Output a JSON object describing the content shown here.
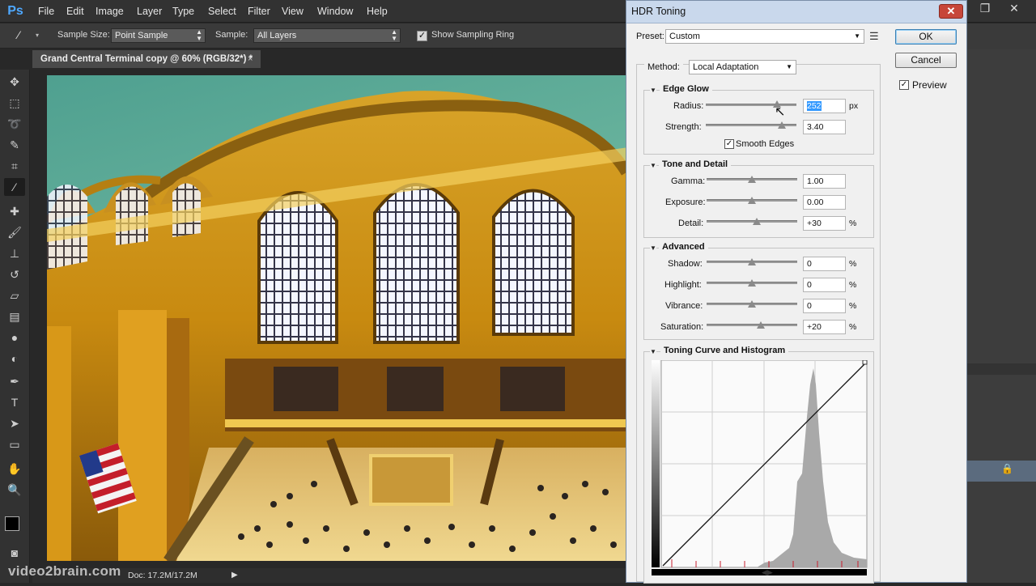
{
  "app": {
    "logo": "Ps",
    "menu": [
      "File",
      "Edit",
      "Image",
      "Layer",
      "Type",
      "Select",
      "Filter",
      "View",
      "Window",
      "Help"
    ]
  },
  "options": {
    "sample_size_label": "Sample Size:",
    "sample_size_value": "Point Sample",
    "sample_label": "Sample:",
    "sample_value": "All Layers",
    "show_ring_label": "Show Sampling Ring",
    "show_ring_checked": true
  },
  "document": {
    "tab_title": "Grand Central Terminal copy @ 60% (RGB/32*) *",
    "close": "×",
    "doc_info": "Doc: 17.2M/17.2M",
    "watermark": "video2brain.com"
  },
  "dialog": {
    "title": "HDR Toning",
    "close": "✕",
    "preset_label": "Preset:",
    "preset_value": "Custom",
    "ok": "OK",
    "cancel": "Cancel",
    "preview_label": "Preview",
    "preview_checked": true,
    "method_label": "Method:",
    "method_value": "Local Adaptation",
    "edge_glow": {
      "title": "Edge Glow",
      "radius_label": "Radius:",
      "radius_value": "252",
      "radius_unit": "px",
      "radius_level": 0.78,
      "strength_label": "Strength:",
      "strength_value": "3.40",
      "strength_level": 0.83,
      "smooth_edges_label": "Smooth Edges",
      "smooth_edges_checked": true
    },
    "tone_detail": {
      "title": "Tone and Detail",
      "gamma_label": "Gamma:",
      "gamma_value": "1.00",
      "gamma_level": 0.5,
      "exposure_label": "Exposure:",
      "exposure_value": "0.00",
      "exposure_level": 0.5,
      "detail_label": "Detail:",
      "detail_value": "+30",
      "detail_unit": "%",
      "detail_level": 0.55
    },
    "advanced": {
      "title": "Advanced",
      "shadow_label": "Shadow:",
      "shadow_value": "0",
      "shadow_level": 0.5,
      "highlight_label": "Highlight:",
      "highlight_value": "0",
      "highlight_level": 0.5,
      "vibrance_label": "Vibrance:",
      "vibrance_value": "0",
      "vibrance_level": 0.5,
      "saturation_label": "Saturation:",
      "saturation_value": "+20",
      "saturation_level": 0.6,
      "unit": "%"
    },
    "curve": {
      "title": "Toning Curve and Histogram"
    }
  },
  "colors": {
    "accent": "#3399ff",
    "dialog_bg": "#f0f0f0",
    "ps_bg": "#282828"
  }
}
